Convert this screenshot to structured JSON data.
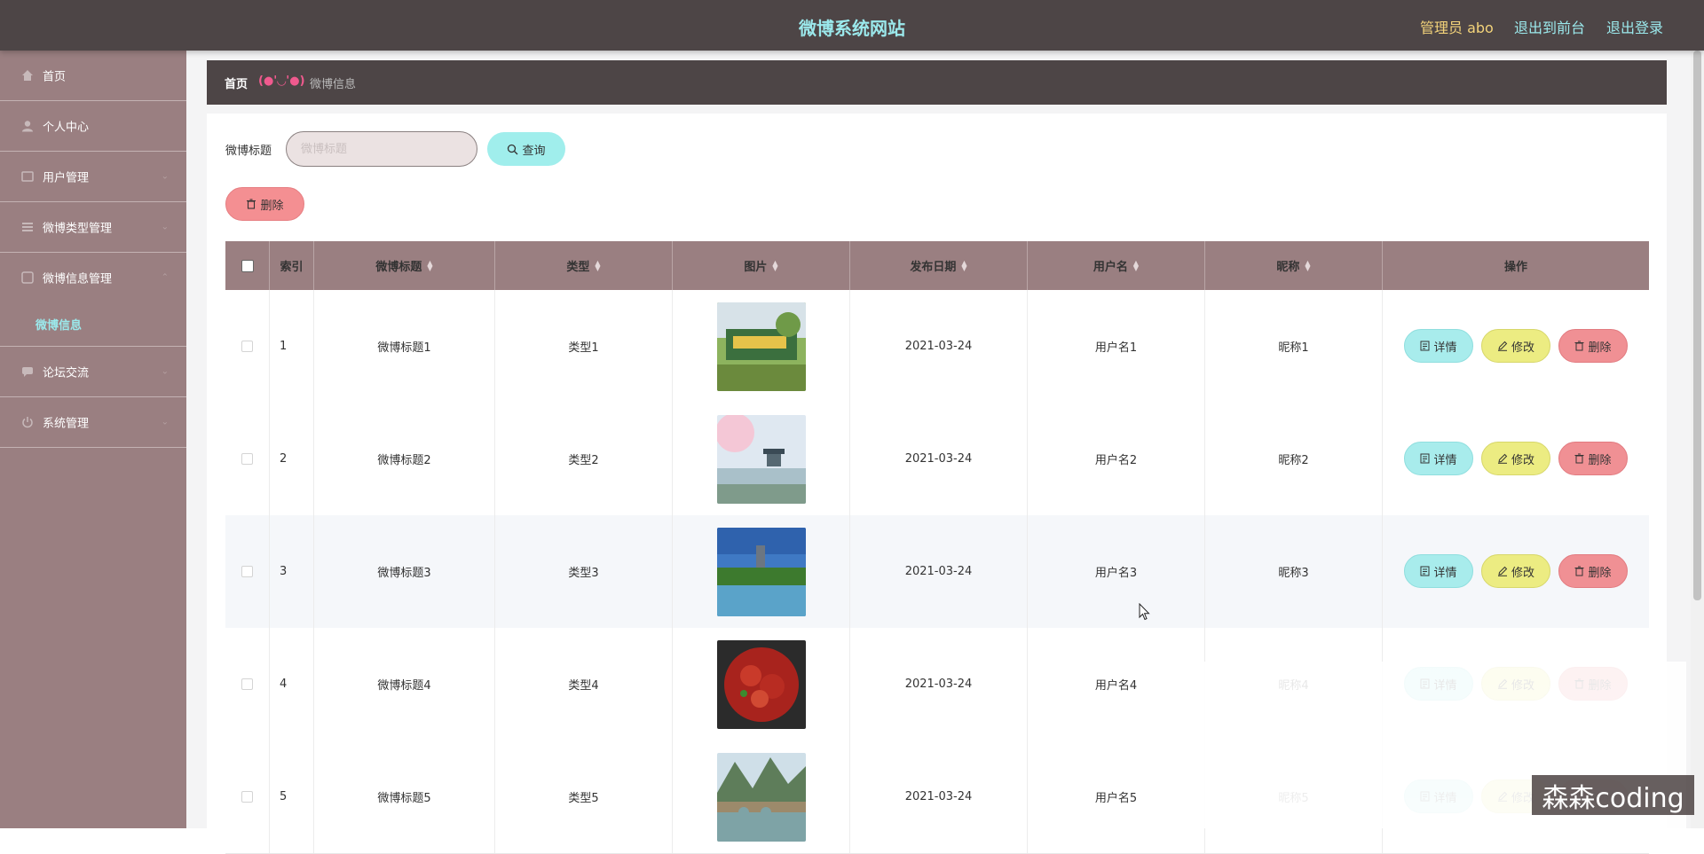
{
  "header": {
    "title": "微博系统网站",
    "admin": "管理员 abo",
    "to_front": "退出到前台",
    "logout": "退出登录"
  },
  "sidebar": {
    "items": [
      {
        "label": "首页",
        "icon": "home-icon"
      },
      {
        "label": "个人中心",
        "icon": "user-icon"
      },
      {
        "label": "用户管理",
        "icon": "users-icon"
      },
      {
        "label": "微博类型管理",
        "icon": "list-icon"
      },
      {
        "label": "微博信息管理",
        "icon": "info-icon"
      },
      {
        "label": "论坛交流",
        "icon": "chat-icon"
      },
      {
        "label": "系统管理",
        "icon": "power-icon"
      }
    ],
    "active_sub": "微博信息"
  },
  "breadcrumb": {
    "home": "首页",
    "face": "(●'◡'●)",
    "current": "微博信息"
  },
  "search": {
    "label": "微博标题",
    "placeholder": "微博标题",
    "query_label": "查询"
  },
  "toolbar": {
    "delete_label": "删除"
  },
  "table": {
    "headers": [
      "索引",
      "微博标题",
      "类型",
      "图片",
      "发布日期",
      "用户名",
      "昵称",
      "操作"
    ],
    "rows": [
      {
        "index": "1",
        "title": "微博标题1",
        "type": "类型1",
        "date": "2021-03-24",
        "username": "用户名1",
        "nickname": "昵称1",
        "image": "park-sign-photo"
      },
      {
        "index": "2",
        "title": "微博标题2",
        "type": "类型2",
        "date": "2021-03-24",
        "username": "用户名2",
        "nickname": "昵称2",
        "image": "pavilion-lake-photo"
      },
      {
        "index": "3",
        "title": "微博标题3",
        "type": "类型3",
        "date": "2021-03-24",
        "username": "用户名3",
        "nickname": "昵称3",
        "image": "pagoda-lake-photo"
      },
      {
        "index": "4",
        "title": "微博标题4",
        "type": "类型4",
        "date": "2021-03-24",
        "username": "用户名4",
        "nickname": "昵称4",
        "image": "crayfish-photo"
      },
      {
        "index": "5",
        "title": "微博标题5",
        "type": "类型5",
        "date": "2021-03-24",
        "username": "用户名5",
        "nickname": "昵称5",
        "image": "bridge-village-photo"
      }
    ],
    "actions": {
      "detail": "详情",
      "edit": "修改",
      "delete": "删除"
    }
  },
  "watermark": "森森coding"
}
